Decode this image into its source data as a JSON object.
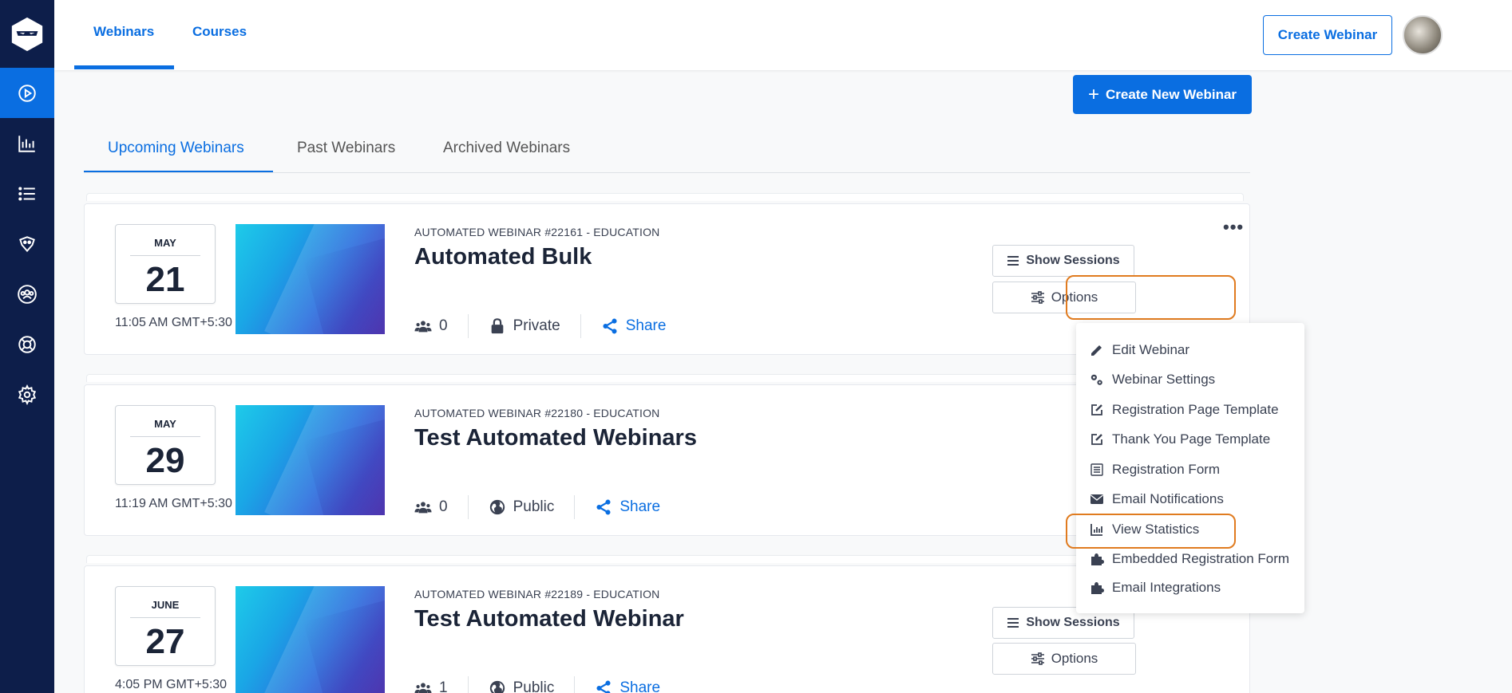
{
  "nav": {
    "top_tabs": [
      "Webinars",
      "Courses"
    ],
    "create_webinar_label": "Create Webinar",
    "sidebar_icons": [
      "play-icon",
      "chart-icon",
      "list-icon",
      "robot-icon",
      "users-icon",
      "lifebuoy-icon",
      "gear-icon"
    ]
  },
  "main": {
    "create_new_label": "Create New Webinar",
    "tabs": [
      "Upcoming Webinars",
      "Past Webinars",
      "Archived Webinars"
    ]
  },
  "webinars": [
    {
      "month": "MAY",
      "day": "21",
      "time": "11:05 AM GMT+5:30",
      "subtitle": "AUTOMATED WEBINAR #22161 - EDUCATION",
      "title": "Automated Bulk",
      "attendees": "0",
      "visibility": "Private",
      "share": "Share"
    },
    {
      "month": "MAY",
      "day": "29",
      "time": "11:19 AM GMT+5:30",
      "subtitle": "AUTOMATED WEBINAR #22180 - EDUCATION",
      "title": "Test Automated Webinars",
      "attendees": "0",
      "visibility": "Public",
      "share": "Share"
    },
    {
      "month": "JUNE",
      "day": "27",
      "time": "4:05 PM GMT+5:30",
      "subtitle": "AUTOMATED WEBINAR #22189 - EDUCATION",
      "title": "Test Automated Webinar",
      "attendees": "1",
      "visibility": "Public",
      "share": "Share"
    }
  ],
  "card_buttons": {
    "show_sessions": "Show Sessions",
    "options": "Options"
  },
  "options_menu": [
    "Edit Webinar",
    "Webinar Settings",
    "Registration Page Template",
    "Thank You Page Template",
    "Registration Form",
    "Email Notifications",
    "View Statistics",
    "Embedded Registration Form",
    "Email Integrations"
  ],
  "colors": {
    "sidebar": "#0d1e4a",
    "accent": "#0a6ee1",
    "highlight": "#e07b1f"
  }
}
